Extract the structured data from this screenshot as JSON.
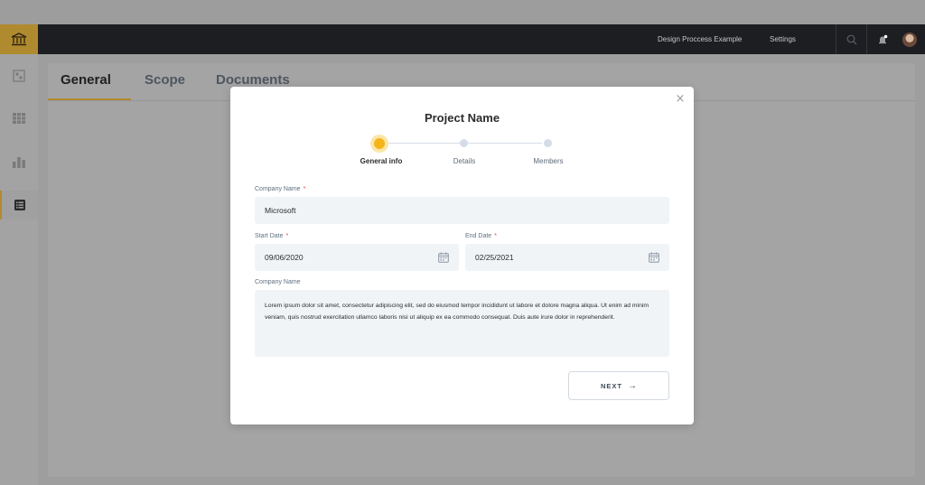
{
  "navbar": {
    "project_link": "Design Proccess Example",
    "settings_link": "Settings"
  },
  "tabs": [
    {
      "label": "General",
      "active": true
    },
    {
      "label": "Scope",
      "active": false
    },
    {
      "label": "Documents",
      "active": false
    }
  ],
  "modal": {
    "title": "Project Name",
    "close_label": "×",
    "steps": [
      {
        "label": "General info",
        "active": true
      },
      {
        "label": "Details",
        "active": false
      },
      {
        "label": "Members",
        "active": false
      }
    ],
    "company_name": {
      "label": "Company Name",
      "required_mark": "*",
      "value": "Microsoft"
    },
    "start_date": {
      "label": "Start Date",
      "required_mark": "*",
      "value": "09/06/2020"
    },
    "end_date": {
      "label": "End Date",
      "required_mark": "*",
      "value": "02/25/2021"
    },
    "description": {
      "label": "Company Name",
      "value": "Lorem ipsum dolor sit amet, consectetur adipiscing elit, sed do eiusmod tempor incididunt ut labore et dolore magna aliqua. Ut enim ad minim veniam, quis nostrud exercitation ullamco laboris nisi ut aliquip ex ea commodo consequat. Duis aute irure dolor in reprehenderit."
    },
    "next_button": {
      "label": "NEXT",
      "icon": "arrow-right-icon"
    }
  },
  "sidebar": {
    "icons": [
      "bank-icon",
      "dashboard-icon",
      "grid-icon",
      "bar-chart-icon",
      "list-icon"
    ]
  },
  "colors": {
    "accent": "#f4b41a",
    "brand": "#b08a2e",
    "navbar": "#1c1e22",
    "required": "#e04848"
  }
}
